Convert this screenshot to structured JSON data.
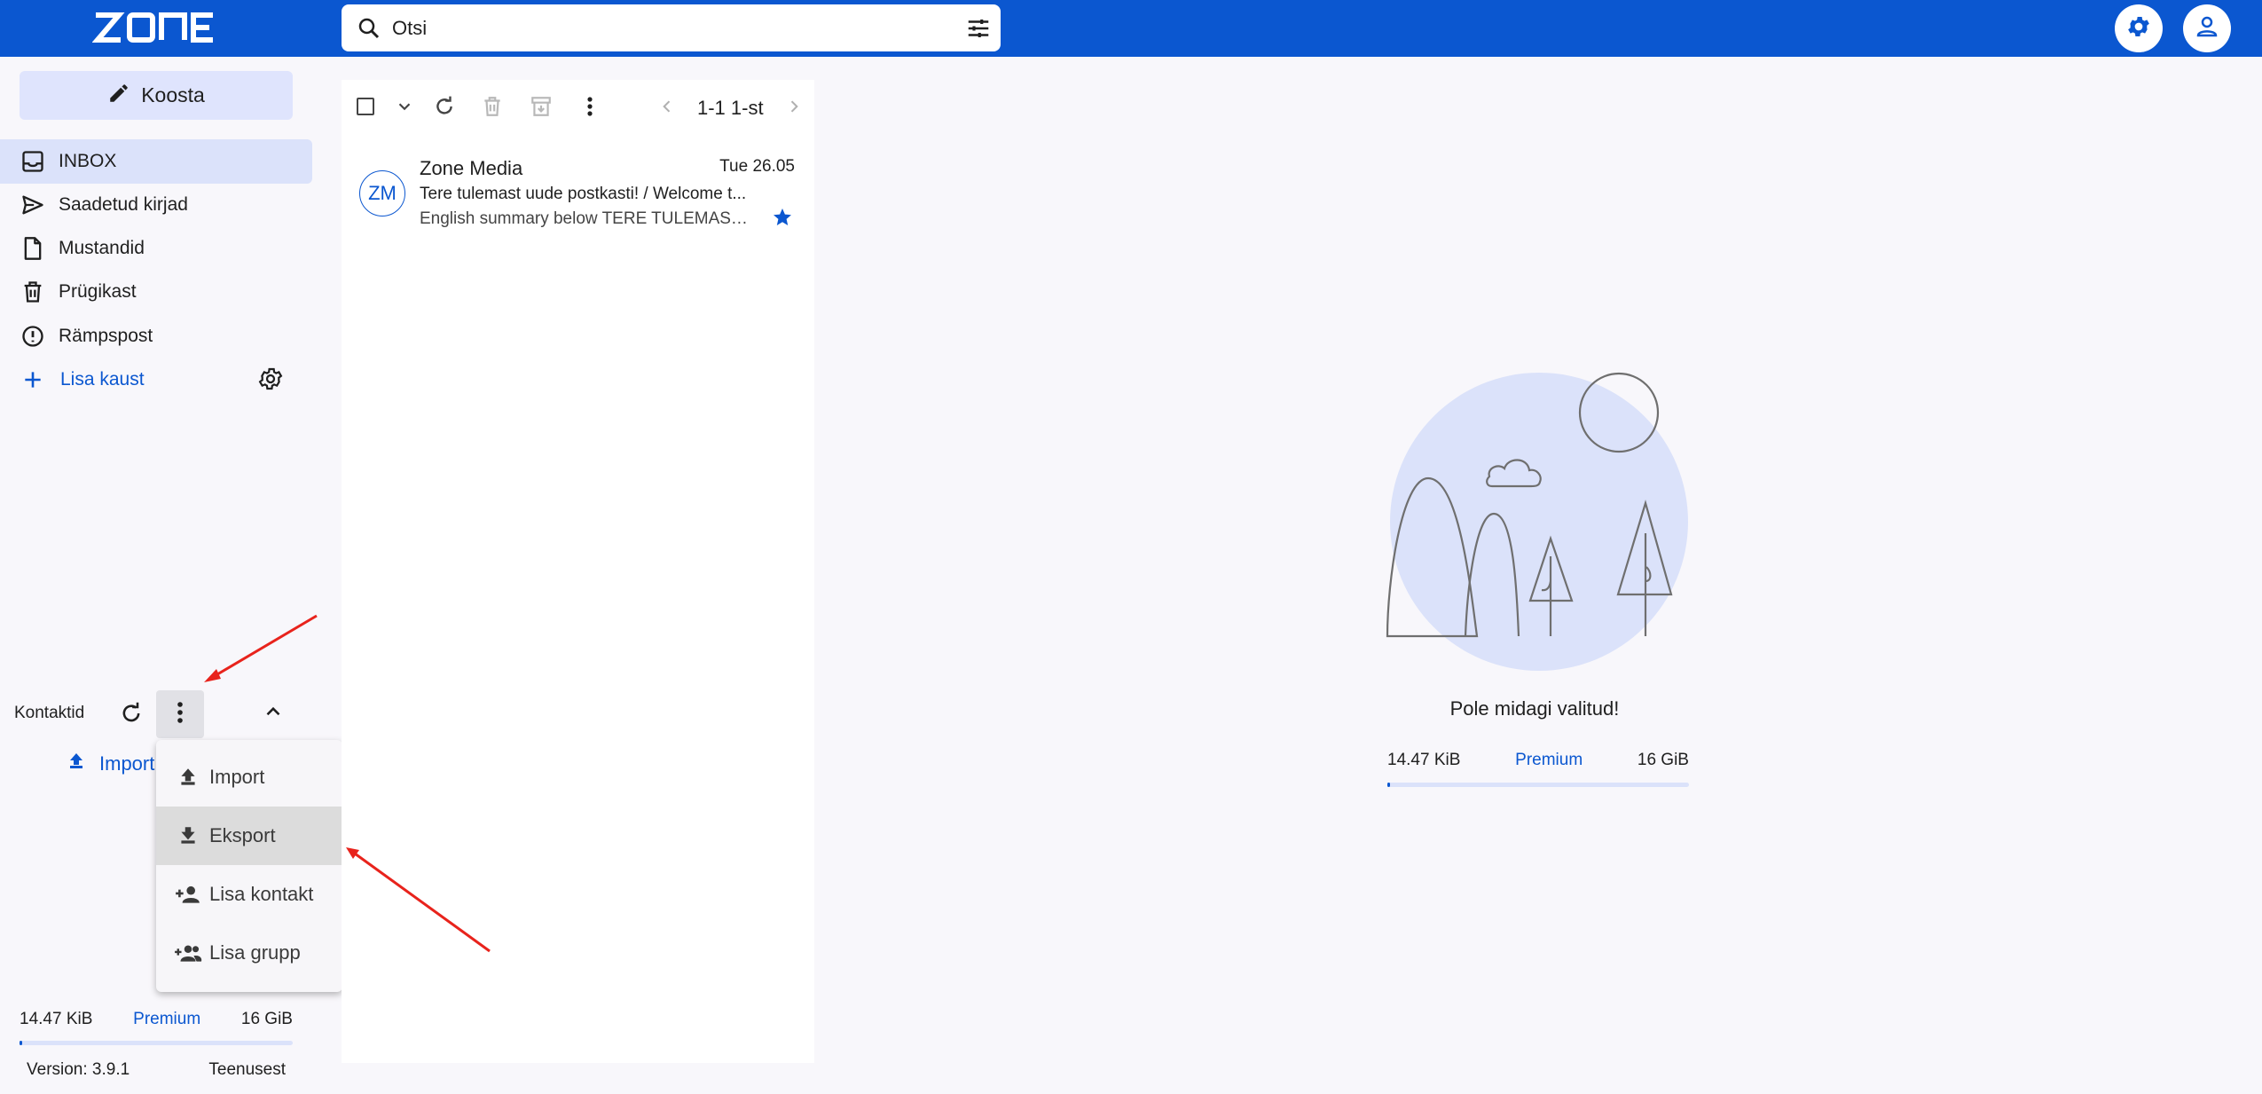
{
  "app": {
    "logo": "ZONE"
  },
  "search": {
    "placeholder": "Otsi"
  },
  "sidebar": {
    "compose_label": "Koosta",
    "items": [
      {
        "label": "INBOX",
        "icon": "inbox-icon",
        "active": true
      },
      {
        "label": "Saadetud kirjad",
        "icon": "send-icon"
      },
      {
        "label": "Mustandid",
        "icon": "draft-icon"
      },
      {
        "label": "Prügikast",
        "icon": "trash-icon"
      },
      {
        "label": "Rämpspost",
        "icon": "spam-icon"
      }
    ],
    "add_folder_label": "Lisa kaust",
    "contacts_label": "Kontaktid",
    "import_label": "Import",
    "quota": {
      "used": "14.47 KiB",
      "plan": "Premium",
      "total": "16 GiB",
      "used_fraction": 0.001
    },
    "version": "Version: 3.9.1",
    "about_label": "Teenusest"
  },
  "contacts_menu": {
    "items": [
      {
        "label": "Import",
        "icon": "upload-icon"
      },
      {
        "label": "Eksport",
        "icon": "download-icon",
        "highlighted": true
      },
      {
        "label": "Lisa kontakt",
        "icon": "person-add-icon"
      },
      {
        "label": "Lisa grupp",
        "icon": "group-add-icon"
      }
    ]
  },
  "toolbar": {
    "pager": "1-1 1-st"
  },
  "messages": [
    {
      "avatar": "ZM",
      "sender": "Zone Media",
      "date": "Tue 26.05",
      "subject": "Tere tulemast uude postkasti! / Welcome t...",
      "preview": "English summary below TERE TULEMAST ...",
      "starred": true
    }
  ],
  "detail": {
    "empty_text": "Pole midagi valitud!",
    "quota": {
      "used": "14.47 KiB",
      "plan": "Premium",
      "total": "16 GiB",
      "used_fraction": 0.001
    }
  },
  "colors": {
    "primary": "#0b57d0",
    "annotation": "#e8231c"
  }
}
